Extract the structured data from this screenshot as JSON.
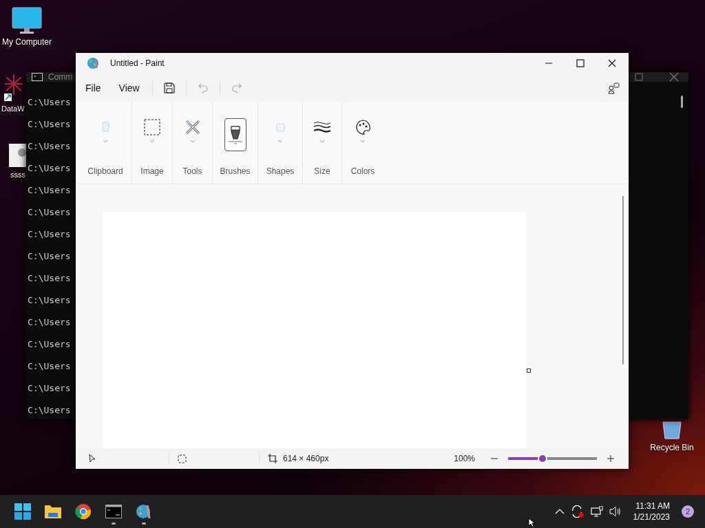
{
  "desktop": {
    "icons": [
      {
        "label": "My Computer",
        "kind": "monitor"
      },
      {
        "label": "DataW",
        "kind": "app"
      },
      {
        "label": "ssss",
        "kind": "file"
      },
      {
        "label": "Recycle Bin",
        "kind": "bin"
      }
    ]
  },
  "console": {
    "title": "Comm",
    "lines": [
      "C:\\Users",
      "C:\\Users",
      "C:\\Users",
      "C:\\Users",
      "C:\\Users",
      "C:\\Users",
      "C:\\Users",
      "C:\\Users",
      "C:\\Users",
      "C:\\Users",
      "C:\\Users",
      "C:\\Users",
      "C:\\Users",
      "C:\\Users",
      "C:\\Users"
    ]
  },
  "paint": {
    "title": "Untitled - Paint",
    "menu": [
      "File",
      "View"
    ],
    "toolbar": [
      {
        "kind": "save",
        "disabled": false
      },
      {
        "kind": "undo",
        "disabled": true
      },
      {
        "kind": "redo",
        "disabled": true
      }
    ],
    "ribbon": [
      {
        "label": "Clipboard",
        "kind": "clipboard",
        "selected": false
      },
      {
        "label": "Image",
        "kind": "image",
        "selected": false
      },
      {
        "label": "Tools",
        "kind": "tools",
        "selected": false
      },
      {
        "label": "Brushes",
        "kind": "brushes",
        "selected": true
      },
      {
        "label": "Shapes",
        "kind": "shapes",
        "selected": false
      },
      {
        "label": "Size",
        "kind": "size",
        "selected": false
      },
      {
        "label": "Colors",
        "kind": "colors",
        "selected": false
      }
    ],
    "status": {
      "canvas_size": "614 × 460px",
      "zoom": "100%",
      "zoom_slider": {
        "level": 0.39
      }
    }
  },
  "taskbar": {
    "apps": [
      {
        "kind": "start",
        "running": false
      },
      {
        "kind": "folder",
        "running": false
      },
      {
        "kind": "browser",
        "running": false
      },
      {
        "kind": "terminal",
        "running": true
      },
      {
        "kind": "paint",
        "running": true
      }
    ],
    "time": "11:31 AM",
    "date": "1/21/2023",
    "notifications": "2"
  }
}
